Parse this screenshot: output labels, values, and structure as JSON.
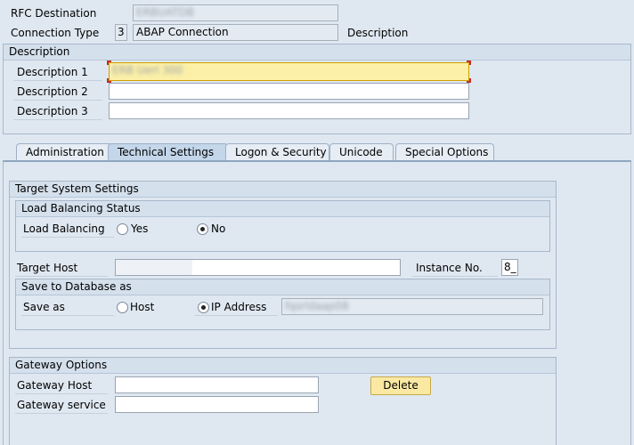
{
  "header": {
    "rfc_destination_label": "RFC Destination",
    "rfc_destination_value": "ERBUATDB",
    "connection_type_label": "Connection Type",
    "connection_type_code": "3",
    "connection_type_value": "ABAP Connection",
    "description_label": "Description"
  },
  "description_group": {
    "title": "Description",
    "desc1_label": "Description 1",
    "desc1_value": "ERB Uerl 300",
    "desc2_label": "Description 2",
    "desc2_value": "",
    "desc3_label": "Description 3",
    "desc3_value": ""
  },
  "tabs": [
    {
      "label": "Administration"
    },
    {
      "label": "Technical Settings",
      "active": true
    },
    {
      "label": "Logon & Security"
    },
    {
      "label": "Unicode"
    },
    {
      "label": "Special Options"
    }
  ],
  "target_system": {
    "title": "Target System Settings",
    "load_balancing_status_title": "Load Balancing Status",
    "load_balancing_label": "Load Balancing",
    "yes_label": "Yes",
    "no_label": "No",
    "selected": "No",
    "target_host_label": "Target Host",
    "target_host_value": "fqsrldaap08",
    "instance_no_label": "Instance No.",
    "instance_no_value": "8_",
    "save_to_db_title": "Save to Database as",
    "save_as_label": "Save as",
    "host_option_label": "Host",
    "ip_option_label": "IP Address",
    "save_as_selected": "IP Address",
    "ip_value": "fqsrldaap08"
  },
  "gateway": {
    "title": "Gateway Options",
    "host_label": "Gateway Host",
    "host_value": "",
    "service_label": "Gateway service",
    "service_value": "",
    "delete_label": "Delete"
  },
  "colors": {
    "background": "#dfe8f1",
    "highlight_field": "#fcf0a8",
    "button": "#fbe9a3"
  }
}
